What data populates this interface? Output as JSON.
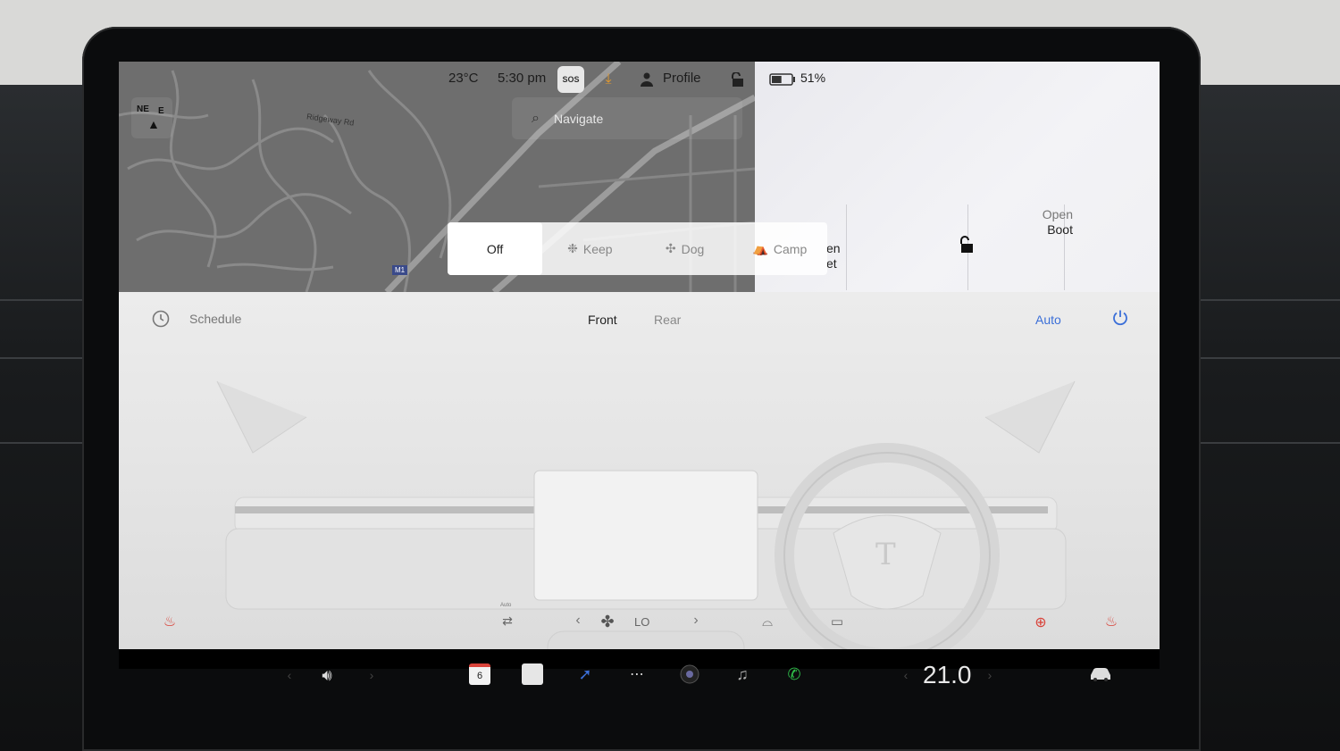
{
  "status": {
    "temperature": "23°C",
    "time": "5:30 pm",
    "sos_label": "SOS",
    "profile_label": "Profile",
    "battery_percent": "51%",
    "battery_level": 0.51
  },
  "map": {
    "search_placeholder": "Navigate",
    "road_label": "Ridgeway Rd",
    "road_badge": "M1",
    "compass_ne": "NE",
    "compass_e": "E"
  },
  "modes": {
    "items": [
      "Off",
      "Keep",
      "Dog",
      "Camp"
    ],
    "selected": "Off"
  },
  "trunk": {
    "frunk_partial_line1": "en",
    "frunk_partial_line2": "et",
    "boot_line1": "Open",
    "boot_line2": "Boot"
  },
  "climate": {
    "schedule_label": "Schedule",
    "tabs": [
      "Front",
      "Rear"
    ],
    "selected_tab": "Front",
    "auto_label": "Auto",
    "fan_speed": "LO",
    "auto_small": "Auto"
  },
  "taskbar": {
    "calendar_day": "6",
    "cabin_temp": "21.0"
  },
  "colors": {
    "accent_blue": "#3b6fd8",
    "download_orange": "#e69a2e",
    "phone_green": "#2fbf4a",
    "heat_red": "#d9433a"
  }
}
